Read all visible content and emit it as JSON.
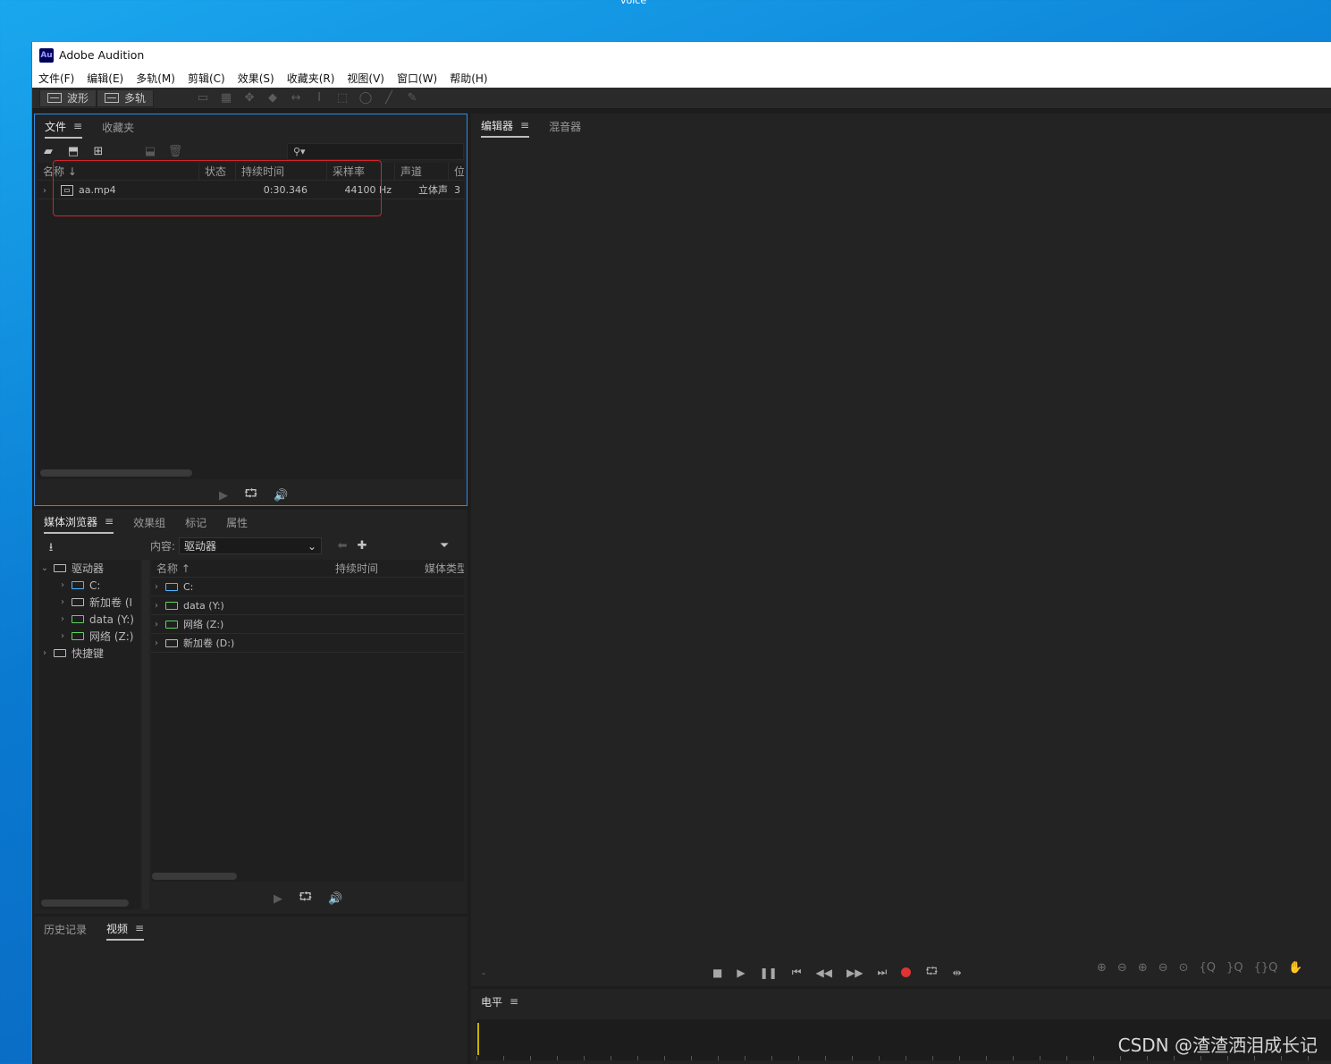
{
  "desktop": {
    "label": "voice"
  },
  "window": {
    "title": "Adobe Audition",
    "logo_text": "Au"
  },
  "menu": [
    "文件(F)",
    "编辑(E)",
    "多轨(M)",
    "剪辑(C)",
    "效果(S)",
    "收藏夹(R)",
    "视图(V)",
    "窗口(W)",
    "帮助(H)"
  ],
  "toolbar": {
    "waveform_label": "波形",
    "multitrack_label": "多轨"
  },
  "files_panel": {
    "tabs": [
      "文件",
      "收藏夹"
    ],
    "search_placeholder": "",
    "columns": [
      "名称",
      "状态",
      "持续时间",
      "采样率",
      "声道",
      "位"
    ],
    "rows": [
      {
        "name": "aa.mp4",
        "status": "",
        "duration": "0:30.346",
        "sample_rate": "44100 Hz",
        "channels": "立体声",
        "bit": "3"
      }
    ]
  },
  "media_browser": {
    "tabs": [
      "媒体浏览器",
      "效果组",
      "标记",
      "属性"
    ],
    "content_label": "内容:",
    "content_value": "驱动器",
    "tree": [
      {
        "label": "驱动器",
        "level": 0,
        "expanded": true
      },
      {
        "label": "C:",
        "level": 1
      },
      {
        "label": "新加卷 (I",
        "level": 1
      },
      {
        "label": "data (Y:)",
        "level": 1
      },
      {
        "label": "网络 (Z:)",
        "level": 1
      },
      {
        "label": "快捷键",
        "level": 0
      }
    ],
    "list_columns": [
      "名称",
      "持续时间",
      "媒体类型"
    ],
    "list_rows": [
      "C:",
      "data (Y:)",
      "网络 (Z:)",
      "新加卷 (D:)"
    ]
  },
  "bottom_left": {
    "tabs": [
      "历史记录",
      "视频"
    ]
  },
  "editor": {
    "tabs": [
      "编辑器",
      "混音器"
    ],
    "time_marker": "-"
  },
  "level": {
    "title": "电平"
  },
  "watermark": "CSDN @渣渣洒泪成长记"
}
